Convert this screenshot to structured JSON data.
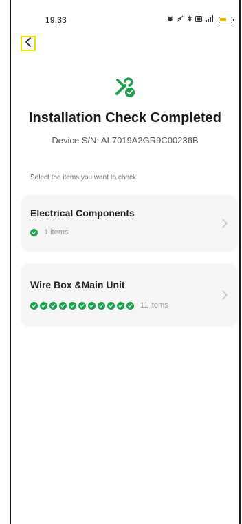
{
  "status_bar": {
    "time": "19:33",
    "icons": [
      "alarm-icon",
      "mute-icon",
      "bluetooth-icon",
      "sim-icon",
      "signal-icon",
      "battery-icon"
    ],
    "battery_level": 0.6
  },
  "header": {
    "back_icon": "chevron-left-icon"
  },
  "hero": {
    "icon": "tools-check-icon",
    "accent_color": "#1aa04a",
    "title": "Installation Check Completed",
    "device_sn": "Device S/N: AL7019A2GR9C00236B"
  },
  "hint": "Select the items you want to check",
  "cards": [
    {
      "title": "Electrical Components",
      "checks": 1,
      "count_label": "1 items"
    },
    {
      "title": "Wire Box &Main Unit",
      "checks": 11,
      "count_label": "11 items"
    }
  ]
}
